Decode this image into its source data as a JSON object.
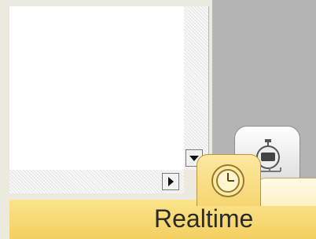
{
  "tabs": {
    "realtime_label": "Realtime",
    "active_icon": "clock-icon",
    "inactive_icon": "stopwatch-icon"
  },
  "scrollbar": {
    "down_icon": "arrow-down-icon",
    "right_icon": "arrow-right-icon"
  },
  "colors": {
    "tab_active": "#f6d672",
    "background_gray": "#b4b4b4",
    "panel_white": "#ffffff"
  }
}
